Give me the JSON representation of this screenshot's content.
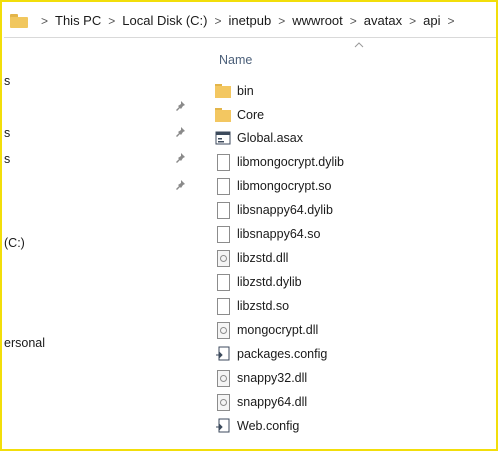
{
  "address_bar": {
    "crumbs": [
      "This PC",
      "Local Disk (C:)",
      "inetpub",
      "wwwroot",
      "avatax",
      "api"
    ],
    "separator": ">"
  },
  "navigation": {
    "partial_items": [
      "s",
      "s",
      "s",
      "(C:)",
      "ersonal"
    ]
  },
  "file_list": {
    "column_header": "Name",
    "items": [
      {
        "name": "bin",
        "type": "folder"
      },
      {
        "name": "Core",
        "type": "folder"
      },
      {
        "name": "Global.asax",
        "type": "asax"
      },
      {
        "name": "libmongocrypt.dylib",
        "type": "file"
      },
      {
        "name": "libmongocrypt.so",
        "type": "file"
      },
      {
        "name": "libsnappy64.dylib",
        "type": "file"
      },
      {
        "name": "libsnappy64.so",
        "type": "file"
      },
      {
        "name": "libzstd.dll",
        "type": "dll"
      },
      {
        "name": "libzstd.dylib",
        "type": "file"
      },
      {
        "name": "libzstd.so",
        "type": "file"
      },
      {
        "name": "mongocrypt.dll",
        "type": "dll"
      },
      {
        "name": "packages.config",
        "type": "config"
      },
      {
        "name": "snappy32.dll",
        "type": "dll"
      },
      {
        "name": "snappy64.dll",
        "type": "dll"
      },
      {
        "name": "Web.config",
        "type": "config"
      }
    ]
  },
  "colors": {
    "frame_border": "#f2de0a",
    "folder": "#f3c761",
    "header_text": "#4c607a"
  }
}
